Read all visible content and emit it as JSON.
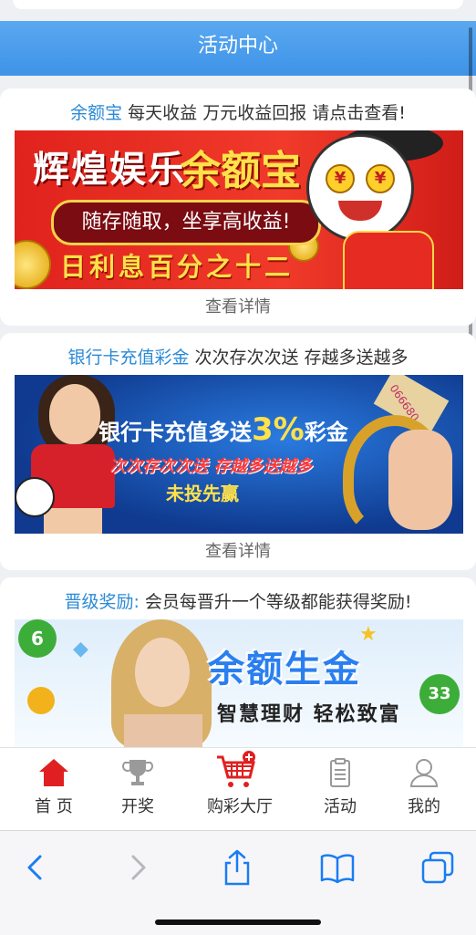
{
  "header": {
    "title": "活动中心"
  },
  "promos": [
    {
      "title_highlight": "余额宝",
      "title_rest": " 每天收益 万元收益回报 请点击查看!",
      "banner": {
        "line1": "辉煌娱乐",
        "line2": "余额宝",
        "line3": "随存随取，坐享高收益!",
        "line4": "日利息百分之十二"
      },
      "details_label": "查看详情"
    },
    {
      "title_highlight": "银行卡充值彩金",
      "title_rest": " 次次存次次送 存越多送越多",
      "banner": {
        "line1_a": "银行卡充值多送",
        "line1_pct": "3%",
        "line1_b": "彩金",
        "line2": "次次存次次送 存越多送越多",
        "line3": "未投先赢",
        "url": "066680.com"
      },
      "details_label": "查看详情"
    },
    {
      "title_highlight": "晋级奖励:",
      "title_rest": " 会员每晋升一个等级都能获得奖励!",
      "banner": {
        "line1": "余额生金",
        "line2": "智慧理财  轻松致富",
        "ball_left": "6",
        "ball_right": "33"
      }
    }
  ],
  "tabbar": {
    "items": [
      {
        "label": "首 页",
        "icon": "home-icon",
        "active": true
      },
      {
        "label": "开奖",
        "icon": "trophy-icon"
      },
      {
        "label": "购彩大厅",
        "icon": "cart-icon"
      },
      {
        "label": "活动",
        "icon": "clipboard-icon"
      },
      {
        "label": "我的",
        "icon": "user-icon"
      }
    ]
  },
  "colors": {
    "header": "#4a9eea",
    "accent_red": "#e02020",
    "link_blue": "#2b8ad6"
  }
}
